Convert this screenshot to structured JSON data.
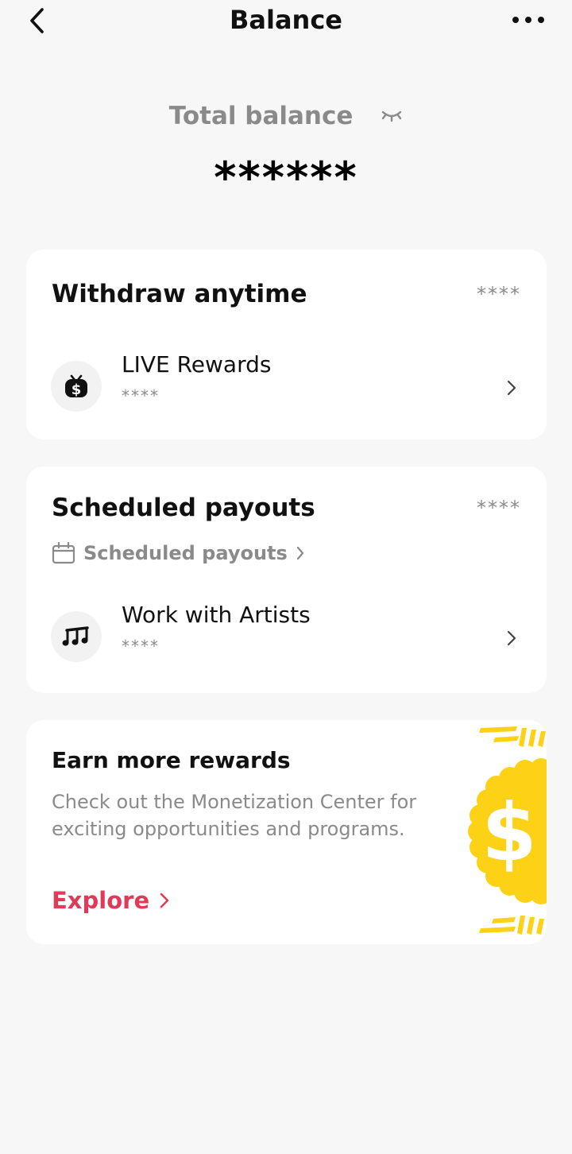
{
  "header": {
    "title": "Balance",
    "back_icon": "chevron-left-icon",
    "more_icon": "more-horizontal-icon"
  },
  "balance": {
    "label": "Total balance",
    "value": "******",
    "visibility_icon": "eye-closed-icon"
  },
  "withdraw_card": {
    "title": "Withdraw anytime",
    "amount": "****",
    "items": [
      {
        "label": "LIVE Rewards",
        "value": "****",
        "icon": "live-rewards-icon"
      }
    ]
  },
  "scheduled_card": {
    "title": "Scheduled payouts",
    "amount": "****",
    "link_label": "Scheduled payouts",
    "link_icon": "calendar-icon",
    "items": [
      {
        "label": "Work with Artists",
        "value": "****",
        "icon": "music-notes-icon"
      }
    ]
  },
  "earn_card": {
    "title": "Earn more rewards",
    "description": "Check out the Monetization Center for exciting opportunities and programs.",
    "link_label": "Explore",
    "illustration": "dollar-coin-badge",
    "accent_color": "#e03a58",
    "coin_color": "#fcd116"
  },
  "colors": {
    "background": "#f7f7f7",
    "card": "#ffffff",
    "muted_text": "#8a8a8a",
    "primary_text": "#111111"
  }
}
